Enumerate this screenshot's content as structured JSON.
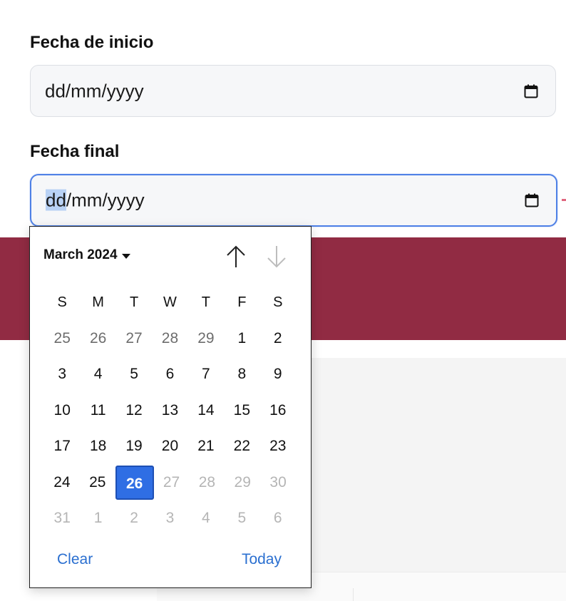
{
  "start_date": {
    "label": "Fecha de inicio",
    "placeholder": "dd/mm/yyyy"
  },
  "end_date": {
    "label": "Fecha final",
    "placeholder_selected_segment": "dd",
    "placeholder_rest": "/mm/yyyy"
  },
  "calendar": {
    "month_label": "March 2024",
    "weekdays": [
      "S",
      "M",
      "T",
      "W",
      "T",
      "F",
      "S"
    ],
    "weeks": [
      [
        {
          "d": "25",
          "s": "other"
        },
        {
          "d": "26",
          "s": "other"
        },
        {
          "d": "27",
          "s": "other"
        },
        {
          "d": "28",
          "s": "other"
        },
        {
          "d": "29",
          "s": "other"
        },
        {
          "d": "1",
          "s": "cur"
        },
        {
          "d": "2",
          "s": "cur"
        }
      ],
      [
        {
          "d": "3",
          "s": "cur"
        },
        {
          "d": "4",
          "s": "cur"
        },
        {
          "d": "5",
          "s": "cur"
        },
        {
          "d": "6",
          "s": "cur"
        },
        {
          "d": "7",
          "s": "cur"
        },
        {
          "d": "8",
          "s": "cur"
        },
        {
          "d": "9",
          "s": "cur"
        }
      ],
      [
        {
          "d": "10",
          "s": "cur"
        },
        {
          "d": "11",
          "s": "cur"
        },
        {
          "d": "12",
          "s": "cur"
        },
        {
          "d": "13",
          "s": "cur"
        },
        {
          "d": "14",
          "s": "cur"
        },
        {
          "d": "15",
          "s": "cur"
        },
        {
          "d": "16",
          "s": "cur"
        }
      ],
      [
        {
          "d": "17",
          "s": "cur"
        },
        {
          "d": "18",
          "s": "cur"
        },
        {
          "d": "19",
          "s": "cur"
        },
        {
          "d": "20",
          "s": "cur"
        },
        {
          "d": "21",
          "s": "cur"
        },
        {
          "d": "22",
          "s": "cur"
        },
        {
          "d": "23",
          "s": "cur"
        }
      ],
      [
        {
          "d": "24",
          "s": "cur"
        },
        {
          "d": "25",
          "s": "cur"
        },
        {
          "d": "26",
          "s": "selected"
        },
        {
          "d": "27",
          "s": "disabled"
        },
        {
          "d": "28",
          "s": "disabled"
        },
        {
          "d": "29",
          "s": "disabled"
        },
        {
          "d": "30",
          "s": "disabled"
        }
      ],
      [
        {
          "d": "31",
          "s": "disabled"
        },
        {
          "d": "1",
          "s": "disabled"
        },
        {
          "d": "2",
          "s": "disabled"
        },
        {
          "d": "3",
          "s": "disabled"
        },
        {
          "d": "4",
          "s": "disabled"
        },
        {
          "d": "5",
          "s": "disabled"
        },
        {
          "d": "6",
          "s": "disabled"
        }
      ]
    ],
    "selected_day": "26",
    "clear_label": "Clear",
    "today_label": "Today",
    "nav_prev_icon": "arrow-up-icon",
    "nav_next_icon": "arrow-down-icon"
  },
  "colors": {
    "accent": "#2f6ee4",
    "band": "#912b43",
    "link": "#2a6fd0",
    "focus_border": "#4e80e6"
  }
}
